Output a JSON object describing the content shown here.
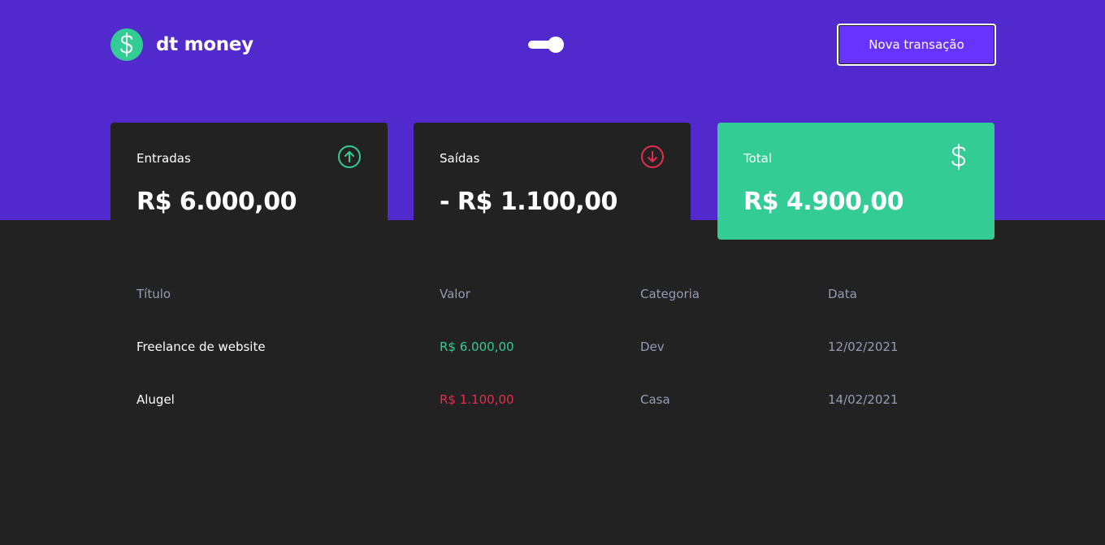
{
  "app": {
    "name": "dt money",
    "new_transaction_label": "Nova transação"
  },
  "summary": {
    "income": {
      "title": "Entradas",
      "value": "R$ 6.000,00",
      "icon": "arrow-up-circle-icon"
    },
    "outcome": {
      "title": "Saídas",
      "value": "- R$ 1.100,00",
      "icon": "arrow-down-circle-icon"
    },
    "total": {
      "title": "Total",
      "value": "R$ 4.900,00",
      "icon": "dollar-sign-icon"
    }
  },
  "table": {
    "headers": [
      "Título",
      "Valor",
      "Categoria",
      "Data"
    ],
    "rows": [
      {
        "title": "Freelance de website",
        "value": "R$ 6.000,00",
        "type": "income",
        "category": "Dev",
        "date": "12/02/2021"
      },
      {
        "title": "Alugel",
        "value": "R$ 1.100,00",
        "type": "outcome",
        "category": "Casa",
        "date": "14/02/2021"
      }
    ]
  },
  "colors": {
    "header": "#5229cc",
    "background": "#222222",
    "green": "#33cc95",
    "red": "#e52e4d",
    "button": "#6933ff",
    "muted": "#969cb3"
  }
}
